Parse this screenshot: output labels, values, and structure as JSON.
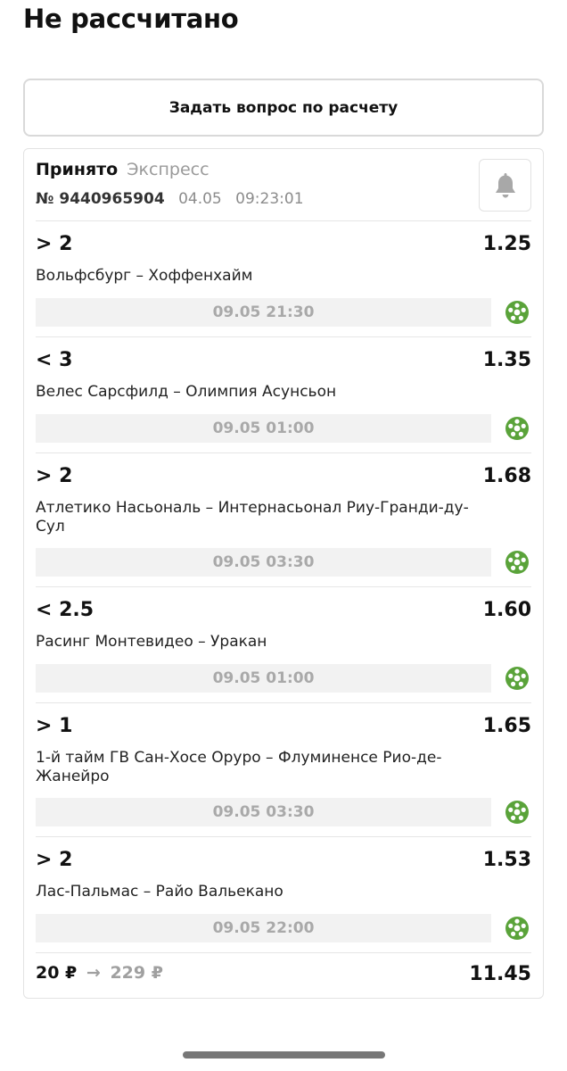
{
  "page": {
    "title": "Не рассчитано",
    "ask_button_label": "Задать вопрос по расчету"
  },
  "bet": {
    "status": "Принято",
    "type": "Экспресс",
    "number": "№ 9440965904",
    "date": "04.05",
    "time": "09:23:01",
    "bell_icon": "bell-icon"
  },
  "events": [
    {
      "outcome": "> 2",
      "odds": "1.25",
      "teams": "Вольфсбург – Хоффенхайм",
      "datetime": "09.05 21:30",
      "sport_icon": "football-icon"
    },
    {
      "outcome": "< 3",
      "odds": "1.35",
      "teams": "Велес Сарсфилд – Олимпия Асунсьон",
      "datetime": "09.05 01:00",
      "sport_icon": "football-icon"
    },
    {
      "outcome": "> 2",
      "odds": "1.68",
      "teams": "Атлетико Насьональ – Интернасьонал Риу-Гранди-ду-Сул",
      "datetime": "09.05 03:30",
      "sport_icon": "football-icon"
    },
    {
      "outcome": "< 2.5",
      "odds": "1.60",
      "teams": "Расинг Монтевидео – Уракан",
      "datetime": "09.05 01:00",
      "sport_icon": "football-icon"
    },
    {
      "outcome": "> 1",
      "odds": "1.65",
      "teams": "1-й тайм ГВ Сан-Хосе Оруро – Флуминенсе Рио-де-Жанейро",
      "datetime": "09.05 03:30",
      "sport_icon": "football-icon"
    },
    {
      "outcome": "> 2",
      "odds": "1.53",
      "teams": "Лас-Пальмас – Райо Вальекано",
      "datetime": "09.05 22:00",
      "sport_icon": "football-icon"
    }
  ],
  "footer": {
    "stake": "20 ₽",
    "arrow": "→",
    "payout": "229 ₽",
    "total_odds": "11.45"
  },
  "colors": {
    "sport_icon": "#5aa33a",
    "date_bar_bg": "#f2f2f2",
    "muted_text": "#9a9a9a"
  }
}
